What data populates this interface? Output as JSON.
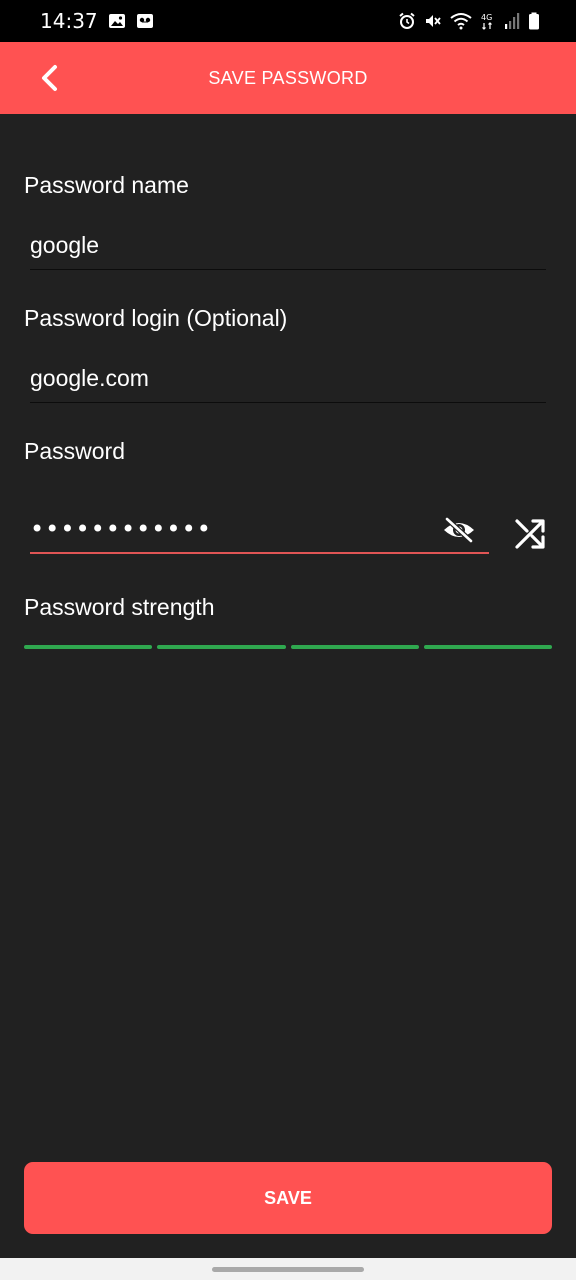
{
  "status_bar": {
    "time": "14:37",
    "left_icons": [
      "image-icon",
      "voicemail-icon"
    ],
    "right_icons": [
      "alarm-icon",
      "mute-icon",
      "wifi-icon",
      "4g-signal-icon",
      "signal-icon",
      "battery-icon"
    ],
    "network_label": "4G"
  },
  "app_bar": {
    "title": "SAVE PASSWORD",
    "back_icon": "chevron-left-icon",
    "color": "#ff5252"
  },
  "form": {
    "name_label": "Password name",
    "name_value": "google",
    "login_label": "Password login (Optional)",
    "login_value": "google.com",
    "password_label": "Password",
    "password_value": "••••••••••••",
    "password_visibility_icon": "eye-off-icon",
    "generate_icon": "shuffle-icon",
    "strength_label": "Password strength",
    "strength_segments": [
      {
        "color": "#2fa84f"
      },
      {
        "color": "#2fa84f"
      },
      {
        "color": "#2fa84f"
      },
      {
        "color": "#2fa84f"
      }
    ]
  },
  "actions": {
    "save_label": "SAVE"
  }
}
